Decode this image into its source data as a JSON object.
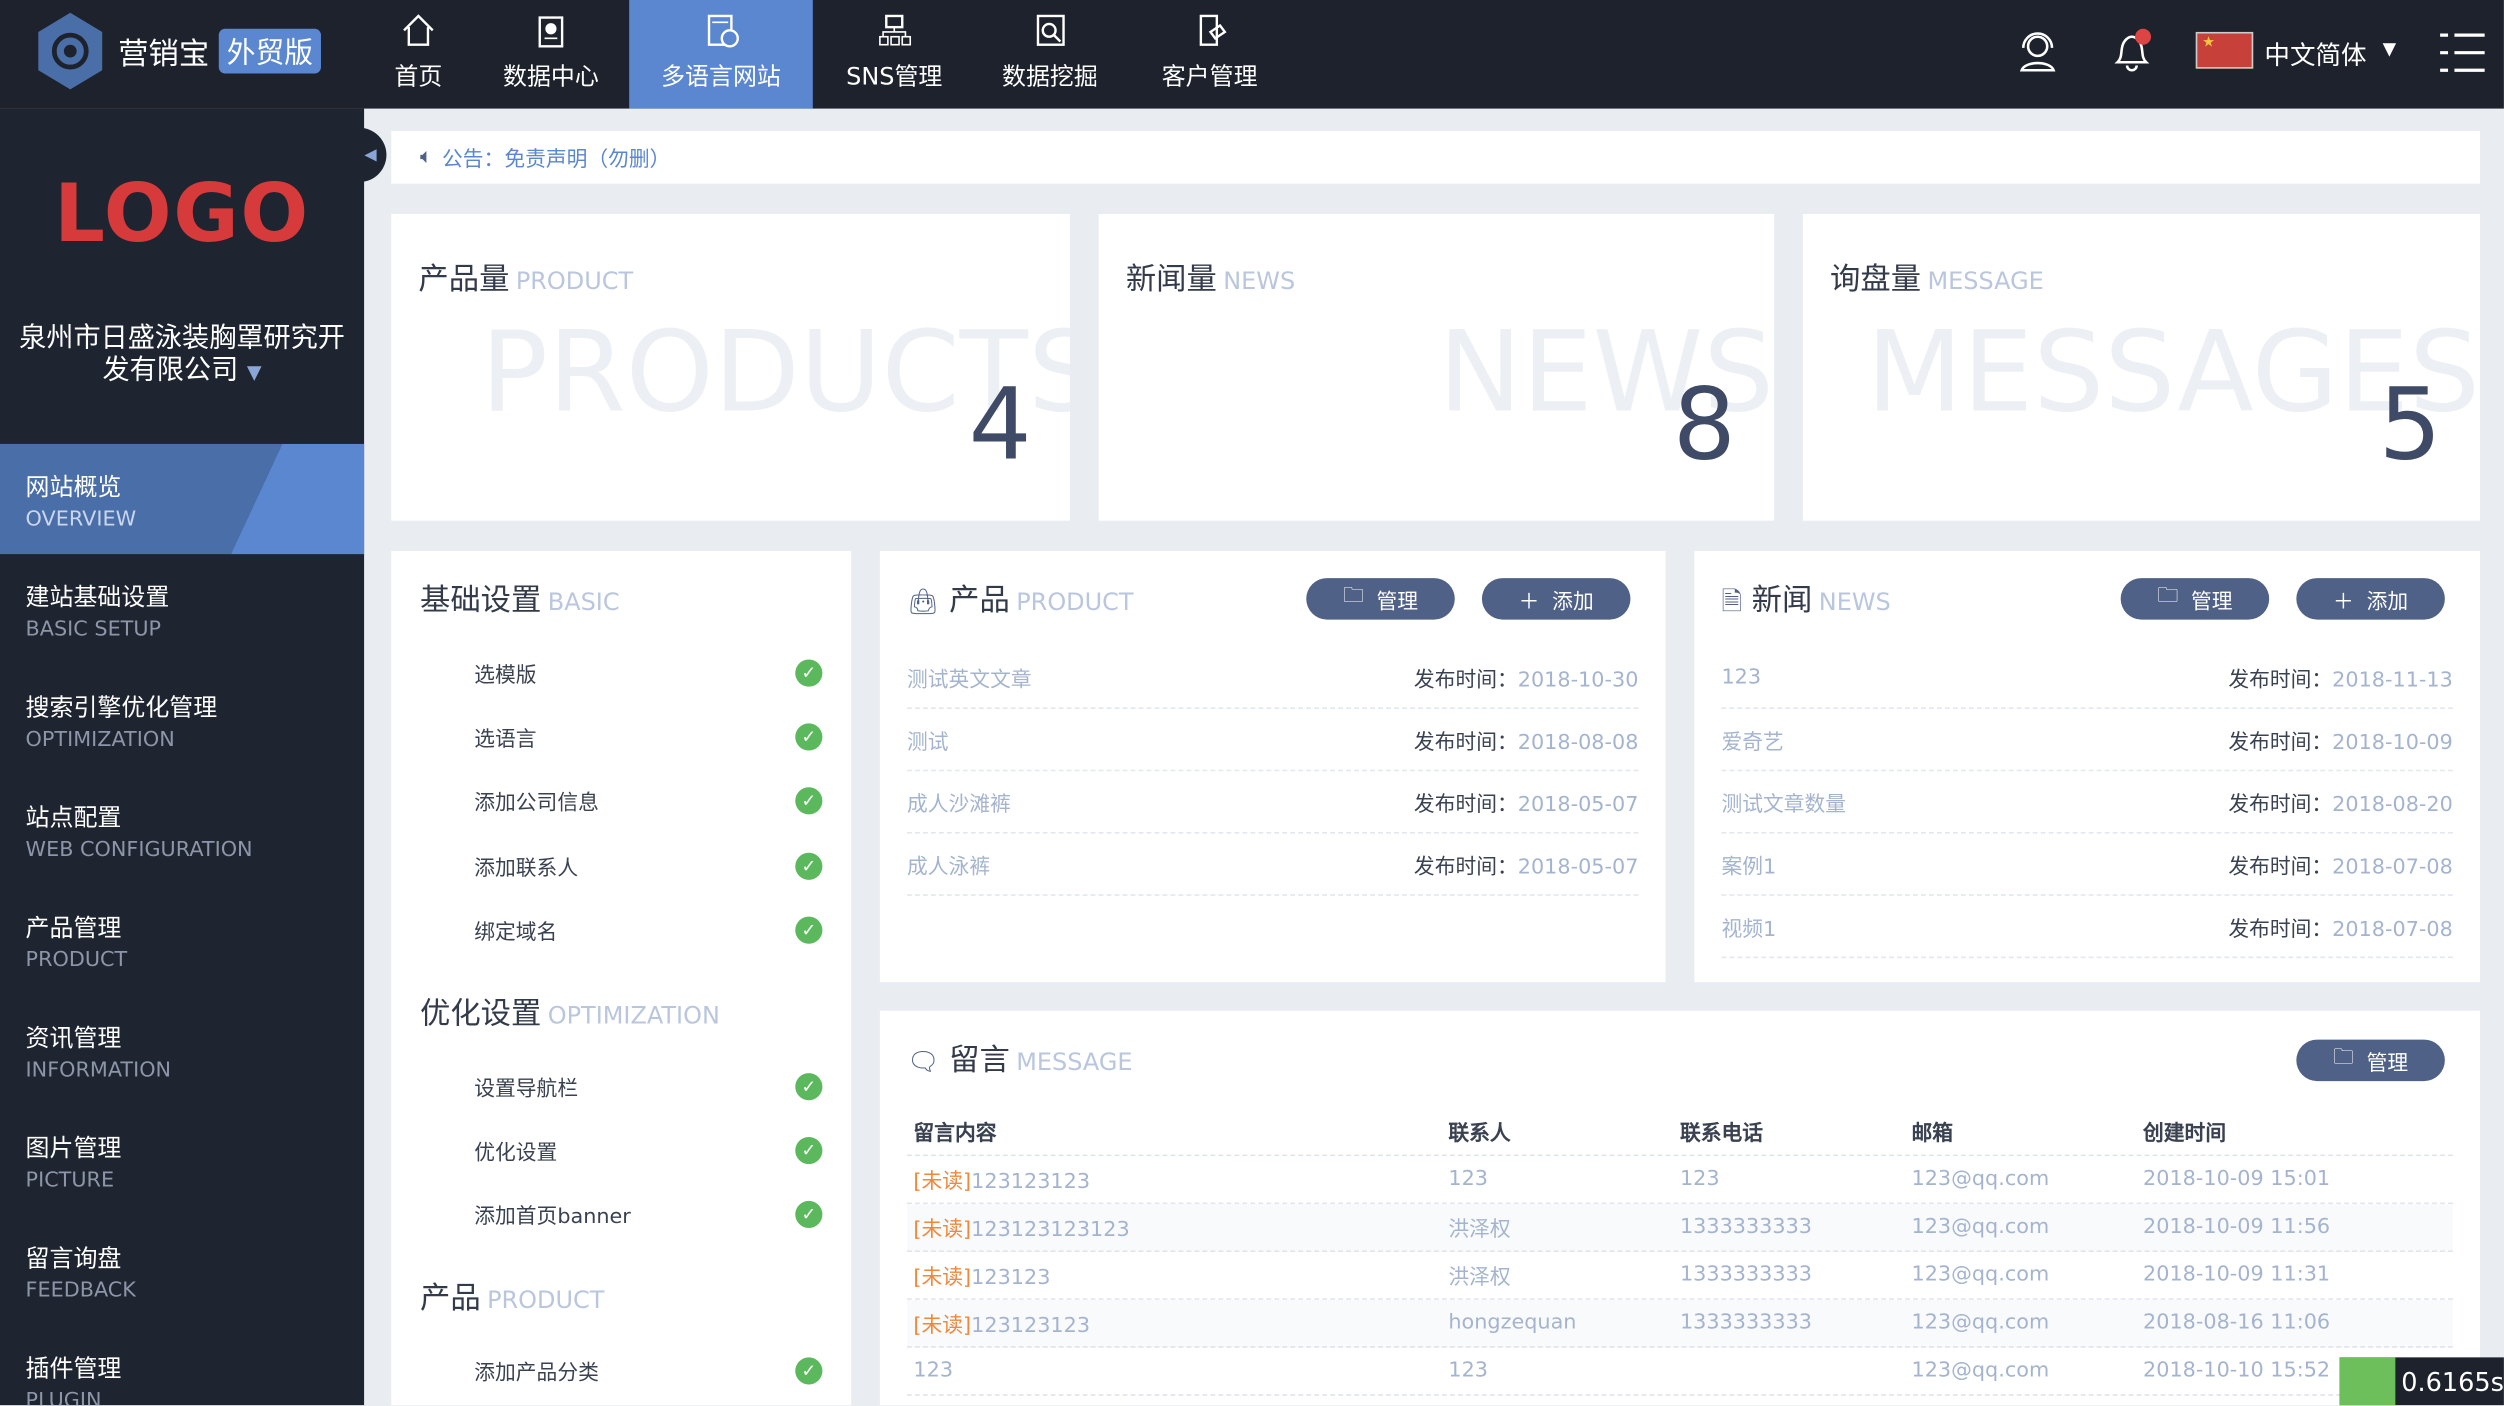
{
  "topbar": {
    "brand": "营销宝",
    "brand_tag": "外贸版",
    "nav": [
      {
        "label": "首页",
        "icon": "home-icon"
      },
      {
        "label": "数据中心",
        "icon": "clipboard-chart-icon"
      },
      {
        "label": "多语言网站",
        "icon": "web-globe-icon",
        "active": true
      },
      {
        "label": "SNS管理",
        "icon": "network-icon"
      },
      {
        "label": "数据挖掘",
        "icon": "search-doc-icon"
      },
      {
        "label": "客户管理",
        "icon": "customer-doc-icon"
      }
    ],
    "language": "中文简体",
    "accent": "#5b87d0"
  },
  "sidebar": {
    "logo": "LOGO",
    "company": "泉州市日盛泳装胸罩研究开发有限公司",
    "items": [
      {
        "cn": "网站概览",
        "en": "OVERVIEW",
        "active": true
      },
      {
        "cn": "建站基础设置",
        "en": "BASIC SETUP"
      },
      {
        "cn": "搜索引擎优化管理",
        "en": "OPTIMIZATION"
      },
      {
        "cn": "站点配置",
        "en": "WEB CONFIGURATION"
      },
      {
        "cn": "产品管理",
        "en": "PRODUCT"
      },
      {
        "cn": "资讯管理",
        "en": "INFORMATION"
      },
      {
        "cn": "图片管理",
        "en": "PICTURE"
      },
      {
        "cn": "留言询盘",
        "en": "FEEDBACK"
      },
      {
        "cn": "插件管理",
        "en": "PLUGIN"
      }
    ]
  },
  "notice": {
    "label": "公告：",
    "text": "免责声明（勿删）"
  },
  "stats": [
    {
      "cn": "产品量",
      "en": "PRODUCT",
      "wm": "PRODUCTS",
      "value": "4"
    },
    {
      "cn": "新闻量",
      "en": "NEWS",
      "wm": "NEWS",
      "value": "8"
    },
    {
      "cn": "询盘量",
      "en": "MESSAGE",
      "wm": "MESSAGES",
      "value": "5"
    }
  ],
  "basic": {
    "title": "基础设置",
    "title_en": "BASIC",
    "items": [
      "选模版",
      "选语言",
      "添加公司信息",
      "添加联系人",
      "绑定域名"
    ],
    "opt_title": "优化设置",
    "opt_en": "OPTIMIZATION",
    "opt_items": [
      "设置导航栏",
      "优化设置",
      "添加首页banner"
    ],
    "prod_title": "产品",
    "prod_en": "PRODUCT",
    "prod_items": [
      "添加产品分类"
    ],
    "check": "✓"
  },
  "buttons": {
    "manage": "管理",
    "add": "添加"
  },
  "product": {
    "title": "产品",
    "title_en": "PRODUCT",
    "date_label": "发布时间：",
    "rows": [
      {
        "t": "测试英文文章",
        "d": "2018-10-30"
      },
      {
        "t": "测试",
        "d": "2018-08-08"
      },
      {
        "t": "成人沙滩裤",
        "d": "2018-05-07"
      },
      {
        "t": "成人泳裤",
        "d": "2018-05-07"
      }
    ]
  },
  "news": {
    "title": "新闻",
    "title_en": "NEWS",
    "date_label": "发布时间：",
    "rows": [
      {
        "t": "123",
        "d": "2018-11-13"
      },
      {
        "t": "爱奇艺",
        "d": "2018-10-09"
      },
      {
        "t": "测试文章数量",
        "d": "2018-08-20"
      },
      {
        "t": "案例1",
        "d": "2018-07-08"
      },
      {
        "t": "视频1",
        "d": "2018-07-08"
      }
    ]
  },
  "message": {
    "title": "留言",
    "title_en": "MESSAGE",
    "headers": [
      "留言内容",
      "联系人",
      "联系电话",
      "邮箱",
      "创建时间"
    ],
    "unread": "[未读]",
    "rows": [
      {
        "u": true,
        "c": "123123123",
        "n": "123",
        "p": "123",
        "e": "123@qq.com",
        "t": "2018-10-09 15:01"
      },
      {
        "u": true,
        "c": "123123123123",
        "n": "洪泽权",
        "p": "1333333333",
        "e": "123@qq.com",
        "t": "2018-10-09 11:56"
      },
      {
        "u": true,
        "c": "123123",
        "n": "洪泽权",
        "p": "1333333333",
        "e": "123@qq.com",
        "t": "2018-10-09 11:31"
      },
      {
        "u": true,
        "c": "123123123",
        "n": "hongzequan",
        "p": "1333333333",
        "e": "123@qq.com",
        "t": "2018-08-16 11:06"
      },
      {
        "u": false,
        "c": "123",
        "n": "123",
        "p": "",
        "e": "123@qq.com",
        "t": "2018-10-10 15:52"
      }
    ]
  },
  "timer": "0.6165s"
}
